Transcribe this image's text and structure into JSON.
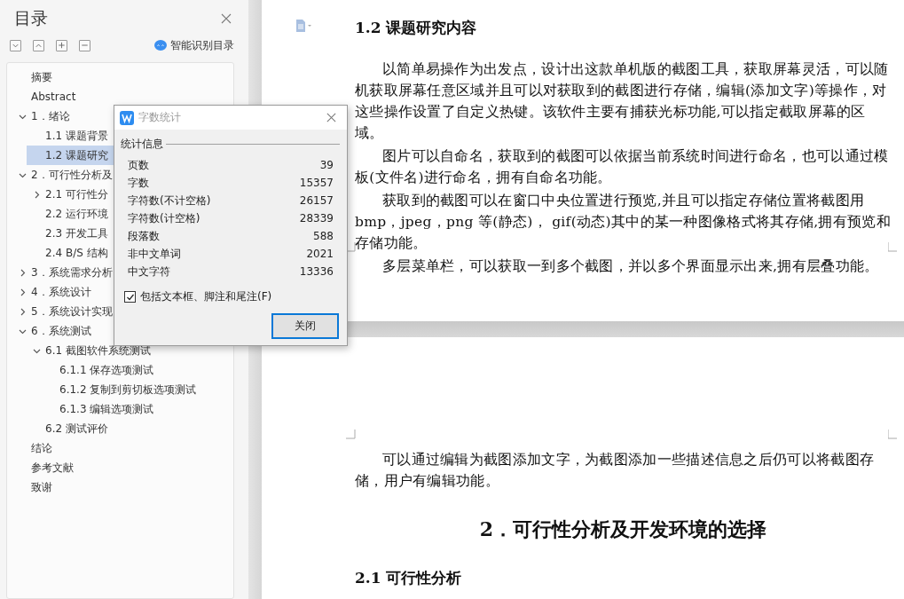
{
  "sidebar": {
    "title": "目录",
    "smart_button": "智能识别目录",
    "items": [
      {
        "label": "摘要",
        "selected": false
      },
      {
        "label": "Abstract",
        "selected": false
      },
      {
        "label": "1．绪论",
        "selected": false,
        "expanded": true,
        "children": [
          {
            "label": "1.1 课题背景",
            "selected": false
          },
          {
            "label": "1.2 课题研究",
            "selected": true
          }
        ]
      },
      {
        "label": "2．可行性分析及",
        "selected": false,
        "expanded": true,
        "children": [
          {
            "label": "2.1 可行性分",
            "selected": false,
            "expanded": false
          },
          {
            "label": "2.2 运行环境",
            "selected": false
          },
          {
            "label": "2.3 开发工具",
            "selected": false
          },
          {
            "label": "2.4 B/S 结构",
            "selected": false
          }
        ]
      },
      {
        "label": "3．系统需求分析",
        "selected": false,
        "expanded": false
      },
      {
        "label": "4．系统设计",
        "selected": false,
        "expanded": false
      },
      {
        "label": "5．系统设计实现",
        "selected": false,
        "expanded": false
      },
      {
        "label": "6．系统测试",
        "selected": false,
        "expanded": true,
        "children": [
          {
            "label": "6.1 截图软件系统测试",
            "selected": false,
            "expanded": true,
            "children": [
              {
                "label": "6.1.1 保存选项测试",
                "selected": false
              },
              {
                "label": "6.1.2 复制到剪切板选项测试",
                "selected": false
              },
              {
                "label": "6.1.3 编辑选项测试",
                "selected": false
              }
            ]
          },
          {
            "label": "6.2 测试评价",
            "selected": false
          }
        ]
      },
      {
        "label": "结论",
        "selected": false
      },
      {
        "label": "参考文献",
        "selected": false
      },
      {
        "label": "致谢",
        "selected": false
      }
    ]
  },
  "dialog": {
    "title": "字数统计",
    "group": "统计信息",
    "stats": [
      {
        "label": "页数",
        "value": "39"
      },
      {
        "label": "字数",
        "value": "15357"
      },
      {
        "label": "字符数(不计空格)",
        "value": "26157"
      },
      {
        "label": "字符数(计空格)",
        "value": "28339"
      },
      {
        "label": "段落数",
        "value": "588"
      },
      {
        "label": "非中文单词",
        "value": "2021"
      },
      {
        "label": "中文字符",
        "value": "13336"
      }
    ],
    "checkbox": {
      "label": "包括文本框、脚注和尾注(F)",
      "checked": true
    },
    "button": "关闭"
  },
  "document": {
    "pages": [
      {
        "blocks": [
          {
            "kind": "heading",
            "text": "1.2 课题研究内容"
          },
          {
            "kind": "paragraph",
            "text": "以简单易操作为出发点，设计出这款单机版的截图工具，获取屏幕灵活，可以随机获取屏幕任意区域并且可以对获取到的截图进行存储，编辑(添加文字)等操作，对这些操作设置了自定义热键。该软件主要有捕获光标功能,可以指定截取屏幕的区域。"
          },
          {
            "kind": "paragraph",
            "text": "图片可以自命名，获取到的截图可以依据当前系统时间进行命名，也可以通过模板(文件名)进行命名，拥有自命名功能。"
          },
          {
            "kind": "paragraph",
            "text": "获取到的截图可以在窗口中央位置进行预览,并且可以指定存储位置将截图用 bmp，jpeg，png 等(静态)，  gif(动态)其中的某一种图像格式将其存储,拥有预览和存储功能。"
          },
          {
            "kind": "paragraph",
            "text": "多层菜单栏，可以获取一到多个截图，并以多个界面显示出来,拥有层叠功能。"
          }
        ]
      },
      {
        "blocks": [
          {
            "kind": "paragraph",
            "text": "可以通过编辑为截图添加文字，为截图添加一些描述信息之后仍可以将截图存储，用户有编辑功能。"
          },
          {
            "kind": "chapter",
            "text": "2．可行性分析及开发环境的选择"
          },
          {
            "kind": "heading",
            "text": "2.1 可行性分析"
          }
        ]
      }
    ]
  }
}
